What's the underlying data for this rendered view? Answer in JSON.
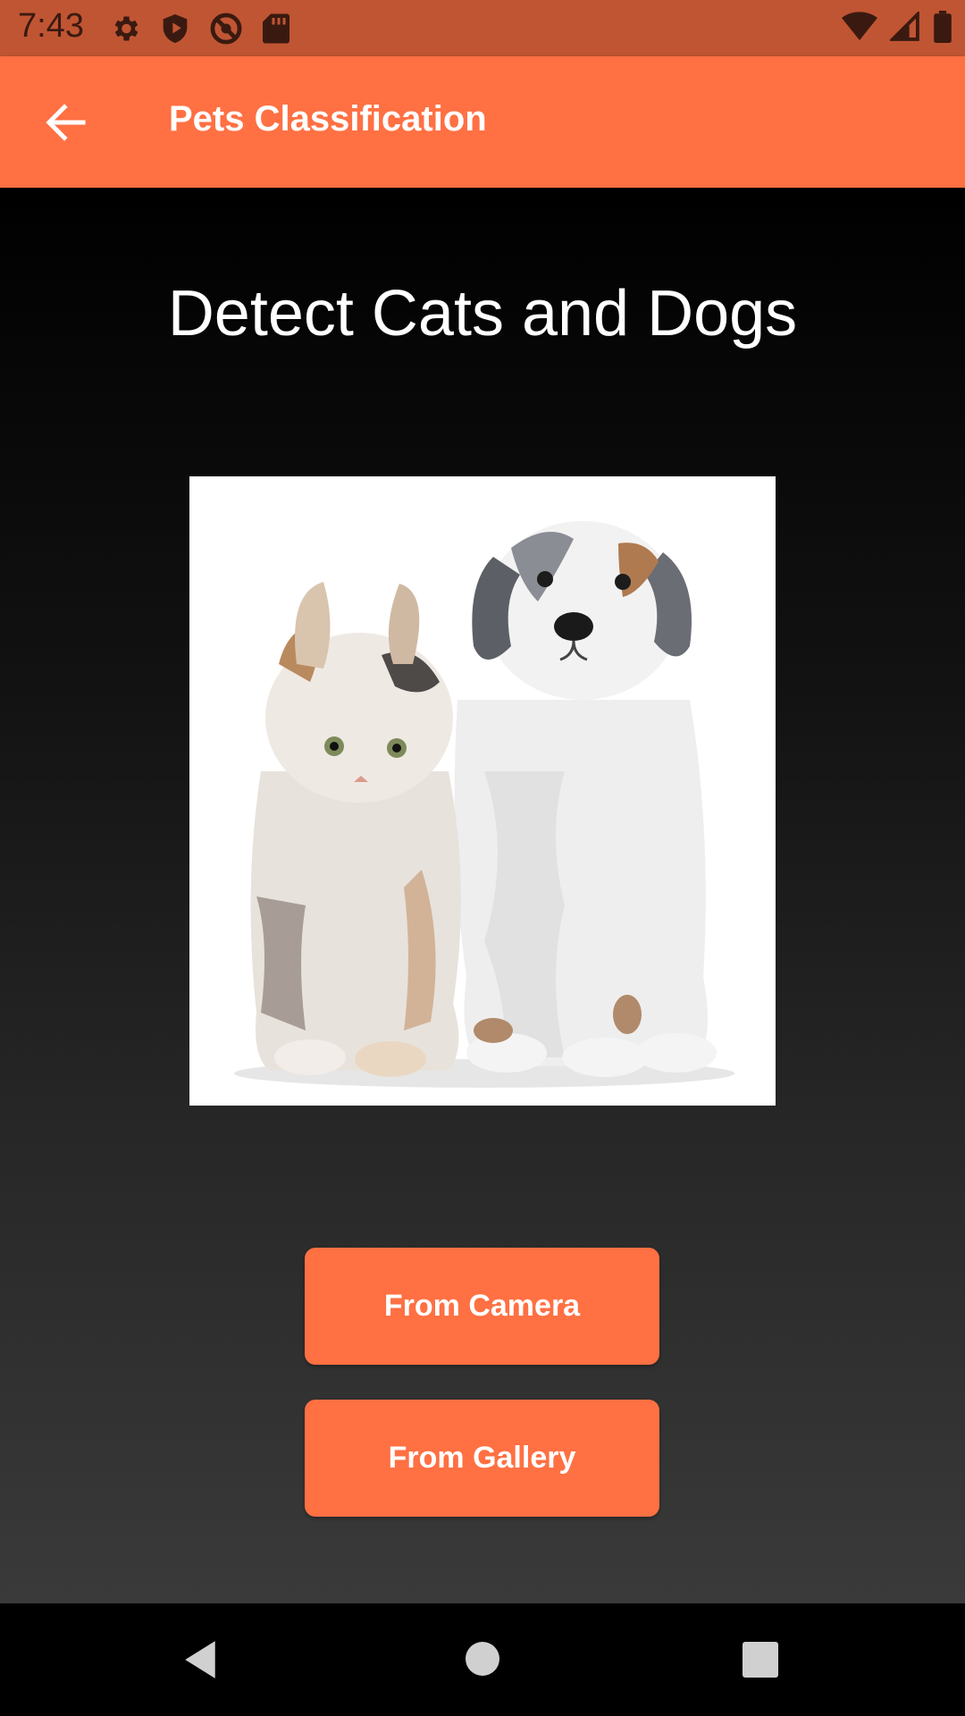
{
  "status_bar": {
    "time": "7:43",
    "left_icons": [
      "settings-icon",
      "shield-play-icon",
      "blocked-icon",
      "sd-card-icon"
    ],
    "right_icons": [
      "wifi-icon",
      "cell-signal-icon",
      "battery-icon"
    ]
  },
  "app_bar": {
    "title": "Pets Classification",
    "back_icon": "arrow-back-icon"
  },
  "main": {
    "heading": "Detect Cats and Dogs",
    "image_subject": "kitten and puppy"
  },
  "buttons": {
    "camera_label": "From Camera",
    "gallery_label": "From Gallery"
  },
  "colors": {
    "accent": "#FF7043",
    "status_bar": "#C05533"
  },
  "nav_bar": {
    "icons": [
      "nav-back-icon",
      "nav-home-icon",
      "nav-recents-icon"
    ]
  }
}
